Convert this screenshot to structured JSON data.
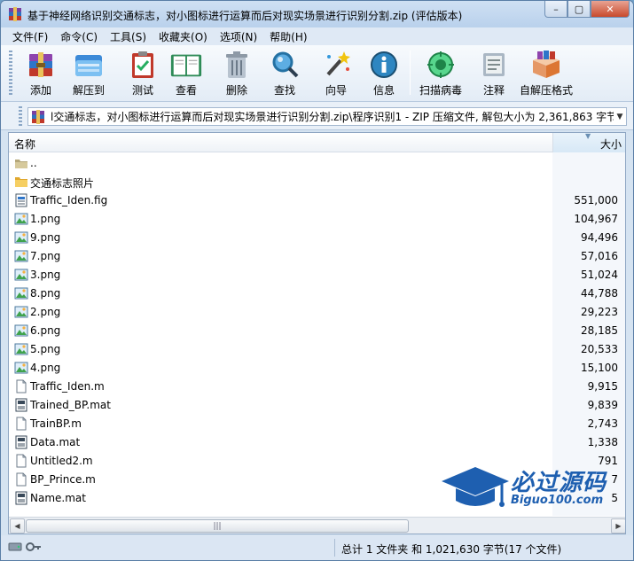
{
  "window": {
    "title": "基于神经网络识别交通标志，对小图标进行运算而后对现实场景进行识别分割.zip (评估版本)",
    "min_label": "–",
    "max_label": "▢",
    "close_label": "✕"
  },
  "menu": [
    "文件(F)",
    "命令(C)",
    "工具(S)",
    "收藏夹(O)",
    "选项(N)",
    "帮助(H)"
  ],
  "toolbar": {
    "add": "添加",
    "extract": "解压到",
    "test": "测试",
    "view": "查看",
    "delete": "删除",
    "find": "查找",
    "wizard": "向导",
    "info": "信息",
    "scan": "扫描病毒",
    "comment": "注释",
    "sfx": "自解压格式"
  },
  "address": {
    "path": "l交通标志，对小图标进行运算而后对现实场景进行识别分割.zip\\程序识别1 - ZIP 压缩文件, 解包大小为 2,361,863 字节"
  },
  "columns": {
    "name": "名称",
    "size": "大小"
  },
  "files": [
    {
      "name": "..",
      "size": "",
      "icon": "up-folder"
    },
    {
      "name": "交通标志照片",
      "size": "",
      "icon": "folder"
    },
    {
      "name": "Traffic_Iden.fig",
      "size": "551,000",
      "icon": "fig-file"
    },
    {
      "name": "1.png",
      "size": "104,967",
      "icon": "image-file"
    },
    {
      "name": "9.png",
      "size": "94,496",
      "icon": "image-file"
    },
    {
      "name": "7.png",
      "size": "57,016",
      "icon": "image-file"
    },
    {
      "name": "3.png",
      "size": "51,024",
      "icon": "image-file"
    },
    {
      "name": "8.png",
      "size": "44,788",
      "icon": "image-file"
    },
    {
      "name": "2.png",
      "size": "29,223",
      "icon": "image-file"
    },
    {
      "name": "6.png",
      "size": "28,185",
      "icon": "image-file"
    },
    {
      "name": "5.png",
      "size": "20,533",
      "icon": "image-file"
    },
    {
      "name": "4.png",
      "size": "15,100",
      "icon": "image-file"
    },
    {
      "name": "Traffic_Iden.m",
      "size": "9,915",
      "icon": "text-file"
    },
    {
      "name": "Trained_BP.mat",
      "size": "9,839",
      "icon": "mat-file"
    },
    {
      "name": "TrainBP.m",
      "size": "2,743",
      "icon": "text-file"
    },
    {
      "name": "Data.mat",
      "size": "1,338",
      "icon": "mat-file"
    },
    {
      "name": "Untitled2.m",
      "size": "791",
      "icon": "text-file"
    },
    {
      "name": "BP_Prince.m",
      "size": "7",
      "icon": "text-file"
    },
    {
      "name": "Name.mat",
      "size": "5",
      "icon": "mat-file"
    }
  ],
  "status": {
    "summary": "总计 1 文件夹 和 1,021,630 字节(17 个文件)"
  },
  "watermark": {
    "title": "必过源码",
    "url": "Biguo100.com"
  }
}
